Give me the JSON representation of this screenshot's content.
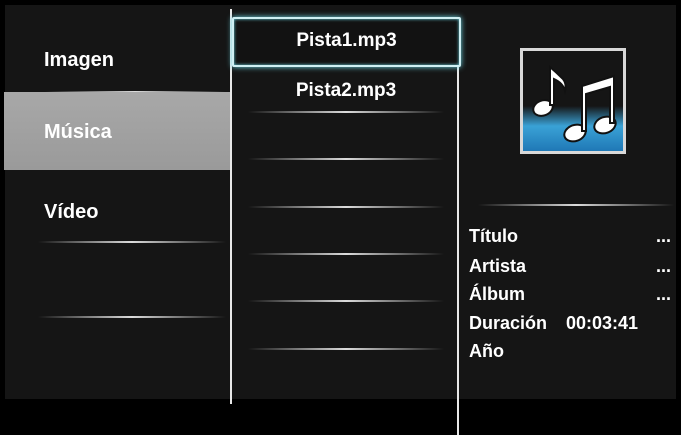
{
  "menu": {
    "items": [
      {
        "label": "Imagen"
      },
      {
        "label": "Música"
      },
      {
        "label": "Vídeo"
      }
    ]
  },
  "files": [
    {
      "name": "Pista1.mp3"
    },
    {
      "name": "Pista2.mp3"
    }
  ],
  "details": {
    "artwork_icon": "music-note-icon",
    "rows": [
      {
        "label": "Título",
        "value": "..."
      },
      {
        "label": "Artista",
        "value": "..."
      },
      {
        "label": "Álbum",
        "value": "..."
      },
      {
        "label": "Duración",
        "value": "00:03:41"
      },
      {
        "label": "Año",
        "value": ""
      }
    ]
  },
  "colors": {
    "background": "#151515",
    "selected_menu": "#a0a0a0",
    "focus_glow": "#6fd8e6",
    "artwork_blue": "#2d90cc"
  }
}
